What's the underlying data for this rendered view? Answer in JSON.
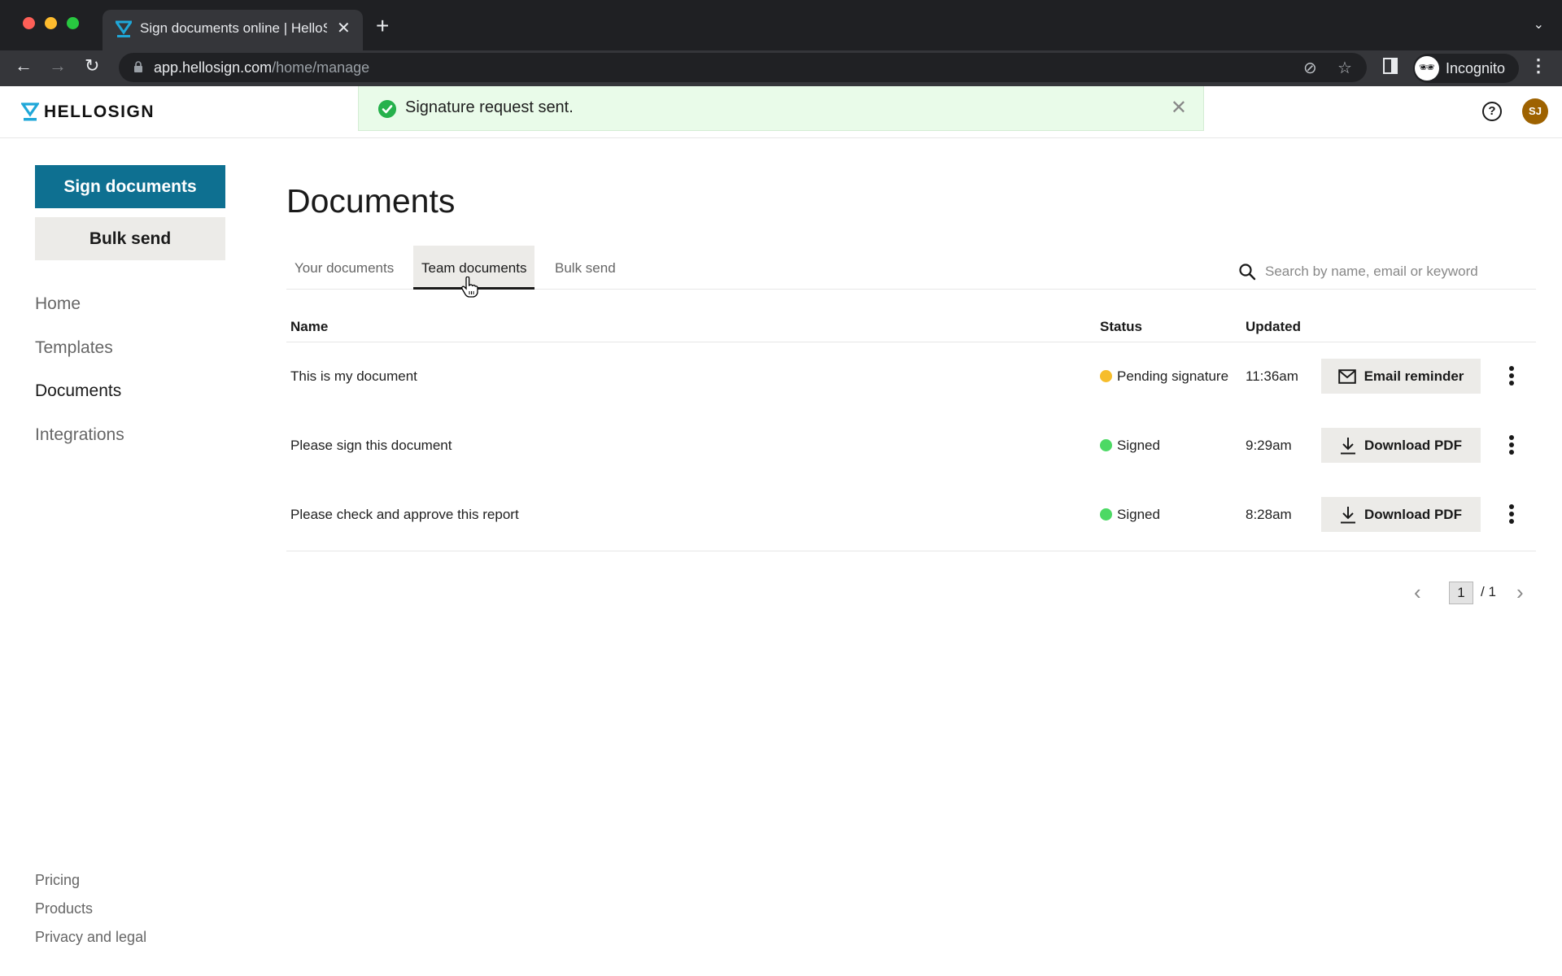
{
  "browser": {
    "tab_title": "Sign documents online | HelloSign",
    "url_host": "app.hellosign.com",
    "url_path": "/home/manage",
    "profile_label": "Incognito"
  },
  "header": {
    "brand": "HELLOSIGN",
    "toast_message": "Signature request sent.",
    "help_label": "?",
    "avatar_initials": "SJ",
    "brand_color": "#1fa7d8",
    "avatar_color": "#9e6200"
  },
  "sidebar": {
    "primary_button": "Sign documents",
    "secondary_button": "Bulk send",
    "nav": [
      {
        "label": "Home",
        "active": false
      },
      {
        "label": "Templates",
        "active": false
      },
      {
        "label": "Documents",
        "active": true
      },
      {
        "label": "Integrations",
        "active": false
      }
    ],
    "footer": [
      {
        "label": "Pricing"
      },
      {
        "label": "Products"
      },
      {
        "label": "Privacy and legal"
      }
    ]
  },
  "main": {
    "title": "Documents",
    "tabs": [
      {
        "label": "Your documents",
        "active": false
      },
      {
        "label": "Team documents",
        "active": true
      },
      {
        "label": "Bulk send",
        "active": false
      }
    ],
    "search_placeholder": "Search by name, email or keyword",
    "columns": {
      "name": "Name",
      "status": "Status",
      "updated": "Updated"
    },
    "rows": [
      {
        "name": "This is my document",
        "status": "Pending signature",
        "status_color": "#f6bd2b",
        "updated": "11:36am",
        "action": "Email reminder",
        "action_icon": "envelope-icon"
      },
      {
        "name": "Please sign this document",
        "status": "Signed",
        "status_color": "#4cd964",
        "updated": "9:29am",
        "action": "Download PDF",
        "action_icon": "download-icon"
      },
      {
        "name": "Please check and approve this report",
        "status": "Signed",
        "status_color": "#4cd964",
        "updated": "8:28am",
        "action": "Download PDF",
        "action_icon": "download-icon"
      }
    ],
    "pagination": {
      "current": "1",
      "total": "/ 1"
    }
  }
}
